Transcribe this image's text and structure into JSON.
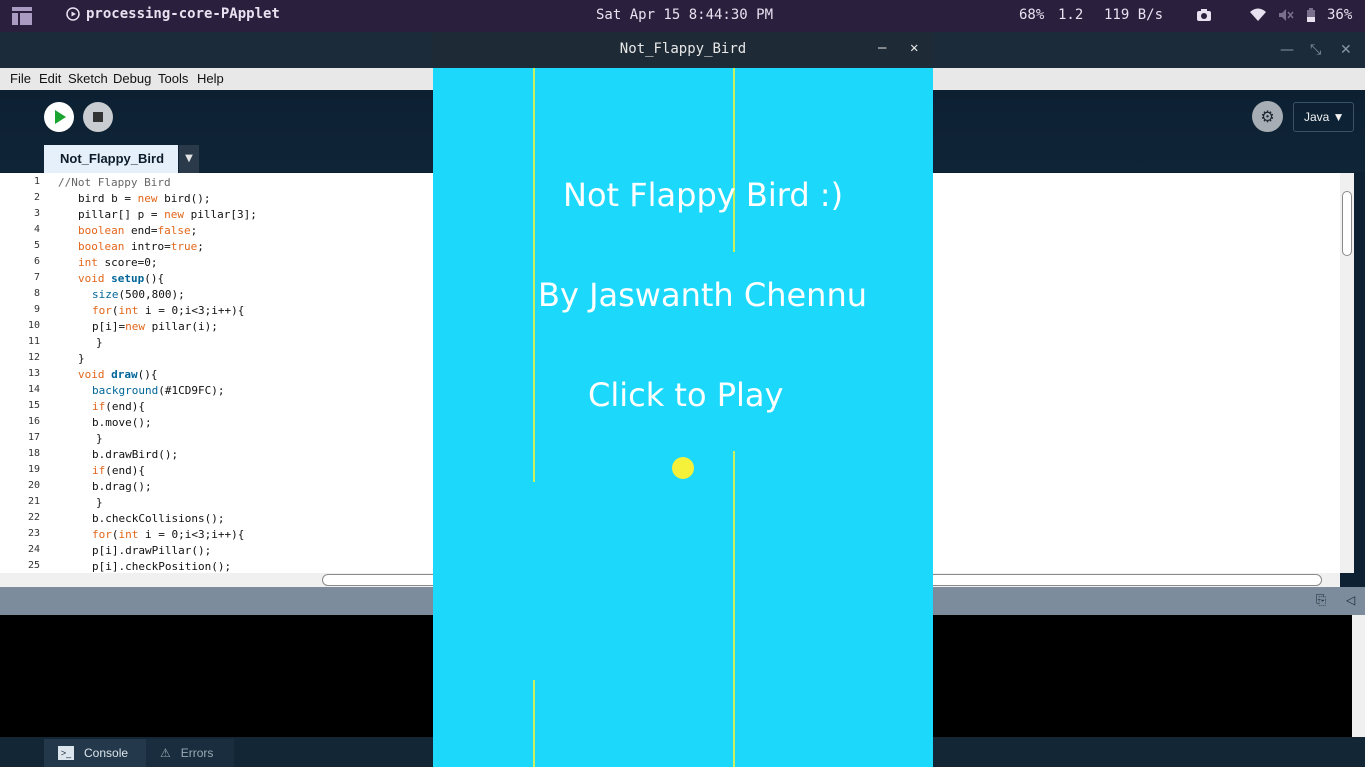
{
  "topbar": {
    "app_title": "processing-core-PApplet",
    "clock": "Sat Apr 15  8:44:30 PM",
    "cpu": "68%",
    "load": "1.2",
    "net": "119 B/s",
    "battery": "36%"
  },
  "menu": [
    "File",
    "Edit",
    "Sketch",
    "Debug",
    "Tools",
    "Help"
  ],
  "toolbar": {
    "mode_label": "Java ▼"
  },
  "editor": {
    "tab_label": "Not_Flappy_Bird",
    "tab_menu": "▼",
    "lines": [
      "//Not Flappy Bird",
      "bird b = new bird();",
      "pillar[] p = new pillar[3];",
      "boolean end=false;",
      "boolean intro=true;",
      "int score=0;",
      "void setup(){",
      "size(500,800);",
      "for(int i = 0;i<3;i++){",
      "p[i]=new pillar(i);",
      "}",
      "}",
      "void draw(){",
      "background(#1CD9FC);",
      "if(end){",
      "b.move();",
      "}",
      "b.drawBird();",
      "if(end){",
      "b.drag();",
      "}",
      "b.checkCollisions();",
      "for(int i = 0;i<3;i++){",
      "p[i].drawPillar();",
      "p[i].checkPosition();"
    ]
  },
  "bottom_tabs": {
    "console": "Console",
    "errors": "Errors"
  },
  "sketch": {
    "window_title": "Not_Flappy_Bird",
    "title_text": "Not Flappy Bird :)",
    "author_text": "By Jaswanth Chennu",
    "play_text": "Click to Play",
    "bg_color": "#1CD9FC"
  }
}
